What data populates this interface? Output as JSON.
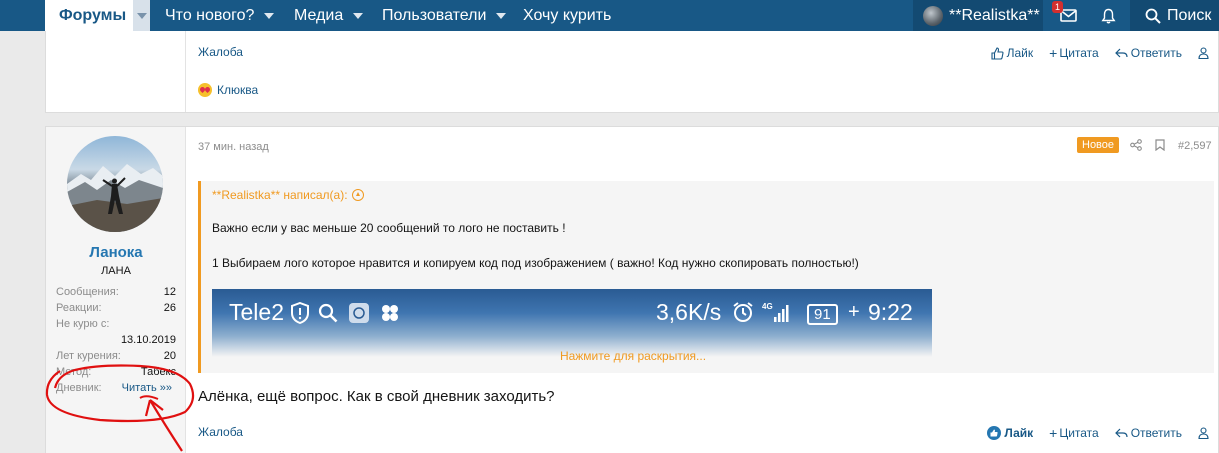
{
  "navbar": {
    "tabs": [
      {
        "label": "Форумы"
      },
      {
        "label": "Что нового?"
      },
      {
        "label": "Медиа"
      },
      {
        "label": "Пользователи"
      },
      {
        "label": "Хочу курить"
      }
    ],
    "username": "**Realistka**",
    "inbox_badge": "1",
    "search_label": "Поиск"
  },
  "post1": {
    "report_label": "Жалоба",
    "like_label": "Лайк",
    "quote_label": "Цитата",
    "reply_label": "Ответить",
    "reaction_user": "Клюква"
  },
  "post2": {
    "time": "37 мин. назад",
    "new_badge": "Новое",
    "post_number": "#2,597",
    "user": {
      "name": "Ланока",
      "title": "ЛАНА",
      "stats": [
        {
          "label": "Сообщения:",
          "value": "12"
        },
        {
          "label": "Реакции:",
          "value": "26"
        },
        {
          "label": "Не курю с:",
          "value": ""
        },
        {
          "label": "",
          "value": "13.10.2019"
        },
        {
          "label": "Лет курения:",
          "value": "20"
        },
        {
          "label": "Метод:",
          "value": "Табекс"
        },
        {
          "label": "Дневник:",
          "value": "Читать »»"
        }
      ]
    },
    "quote": {
      "author": "**Realistka** написал(а):",
      "line1": "Важно если у вас меньше 20 сообщений то лого не поставить !",
      "line2": "1 Выбираем лого которое нравится и копируем код под изображением ( важно! Код нужно скопировать полностью!)",
      "phone_left": "Tele2",
      "phone_speed": "3,6K/s",
      "phone_battery": "91",
      "phone_time": "9:22",
      "expand_label": "Нажмите для раскрытия..."
    },
    "message": "Алёнка, ещё вопрос. Как в свой дневник заходить?",
    "report_label": "Жалоба",
    "like_label": "Лайк",
    "quote_label": "Цитата",
    "reply_label": "Ответить"
  },
  "colors": {
    "nav_bg": "#185886",
    "accent_orange": "#f09a21",
    "link_blue": "#185886",
    "annotation_red": "#e01010"
  }
}
